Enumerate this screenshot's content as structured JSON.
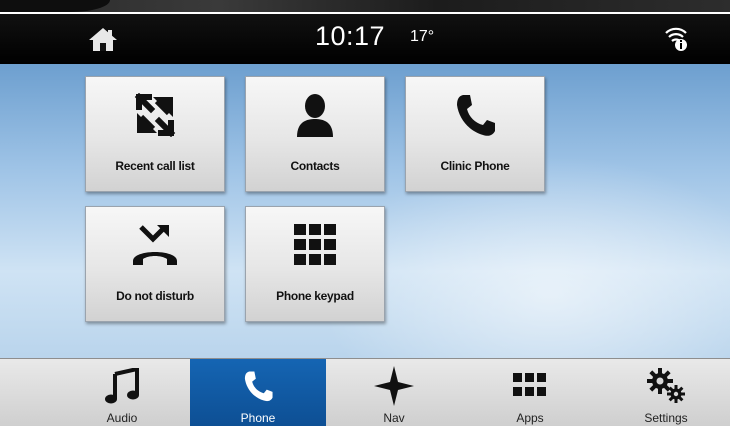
{
  "status_bar": {
    "time": "10:17",
    "temperature": "17°"
  },
  "tiles": [
    {
      "label": "Recent call list",
      "icon": "recent-calls-arrows-icon"
    },
    {
      "label": "Contacts",
      "icon": "contact-person-icon"
    },
    {
      "label": "Clinic Phone",
      "icon": "phone-handset-icon"
    },
    {
      "label": "Do not disturb",
      "icon": "do-not-disturb-phone-icon"
    },
    {
      "label": "Phone keypad",
      "icon": "keypad-grid-icon"
    }
  ],
  "nav": {
    "items": [
      {
        "label": "Audio",
        "icon": "music-note-icon",
        "active": false
      },
      {
        "label": "Phone",
        "icon": "phone-handset-icon",
        "active": true
      },
      {
        "label": "Nav",
        "icon": "compass-star-icon",
        "active": false
      },
      {
        "label": "Apps",
        "icon": "apps-grid-icon",
        "active": false
      },
      {
        "label": "Settings",
        "icon": "gears-icon",
        "active": false
      }
    ]
  },
  "colors": {
    "active_nav": "#1565b3",
    "status_bar": "#000000"
  }
}
